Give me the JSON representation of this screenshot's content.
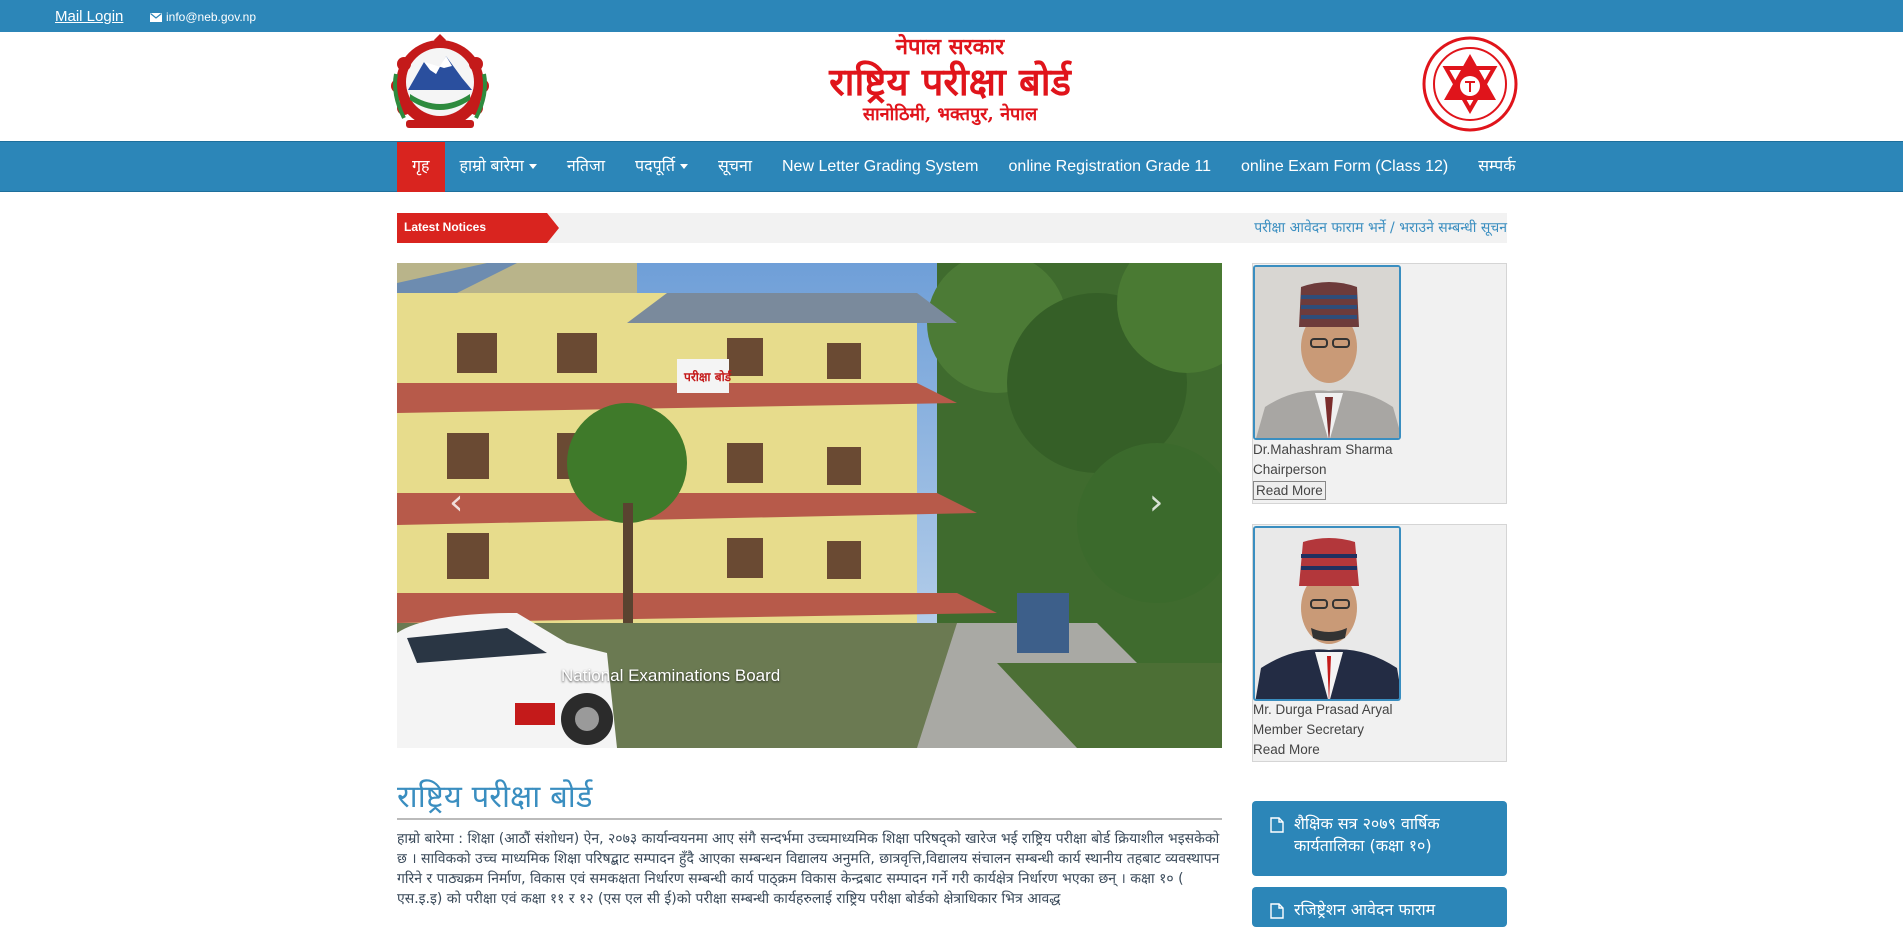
{
  "topbar": {
    "mail_login": "Mail Login",
    "email": "info@neb.gov.np"
  },
  "header": {
    "line1": "नेपाल सरकार",
    "line2": "राष्ट्रिय परीक्षा बोर्ड",
    "line3": "सानोठिमी, भक्तपुर, नेपाल"
  },
  "nav": {
    "items": [
      {
        "label": "गृह"
      },
      {
        "label": "हाम्रो बारेमा"
      },
      {
        "label": "नतिजा"
      },
      {
        "label": "पदपूर्ति"
      },
      {
        "label": "सूचना"
      },
      {
        "label": "New Letter Grading System"
      },
      {
        "label": "online Registration Grade 11"
      },
      {
        "label": "online Exam Form (Class 12)"
      },
      {
        "label": "सम्पर्क"
      }
    ]
  },
  "notices": {
    "label": "Latest Notices",
    "text": "परीक्षा आवेदन फाराम भर्ने / भराउने सम्बन्धी सूचन"
  },
  "carousel": {
    "caption": "National Examinations Board",
    "prev": "‹",
    "next": "›",
    "sign_text": "परीक्षा बोर्ड"
  },
  "people": [
    {
      "name": "Dr.Mahashram Sharma",
      "role": "Chairperson",
      "read_more": "Read More"
    },
    {
      "name": "Mr. Durga Prasad Aryal",
      "role": "Member Secretary",
      "read_more": "Read More"
    }
  ],
  "main": {
    "title": "राष्ट्रिय परीक्षा बोर्ड",
    "about": "हाम्रो बारेमा : शिक्षा (आठौं संशोधन) ऐन, २०७३ कार्यान्वयनमा आए संगै सन्दर्भमा उच्चमाध्यमिक शिक्षा परिषद्को खारेज भई राष्ट्रिय परीक्षा बोर्ड क्रियाशील भइसकेको छ । साविकको उच्च माध्यमिक शिक्षा परिषद्बाट सम्पादन हुँदै आएका सम्बन्धन विद्यालय अनुमति, छात्रवृत्ति,विद्यालय संचालन सम्बन्धी कार्य स्थानीय तहबाट व्यवस्थापन गरिने र पाठ्यक्रम निर्माण, विकास एवं समकक्षता निर्धारण सम्बन्धी कार्य पाठ्क्रम विकास केन्द्रबाट सम्पादन गर्ने गरी कार्यक्षेत्र निर्धारण भएका छन् । कक्षा १० ( एस.इ.इ) को परीक्षा एवं कक्षा ११ र १२ (एस एल सी ई)को परीक्षा सम्बन्धी कार्यहरुलाई  राष्ट्रिय परीक्षा बोर्डको क्षेत्राधिकार भित्र आवद्ध"
  },
  "side_buttons": [
    {
      "label": "शैक्षिक सत्र २०७९ वार्षिक कार्यतालिका (कक्षा १०)"
    },
    {
      "label": "रजिष्ट्रेशन आवेदन फाराम"
    }
  ]
}
